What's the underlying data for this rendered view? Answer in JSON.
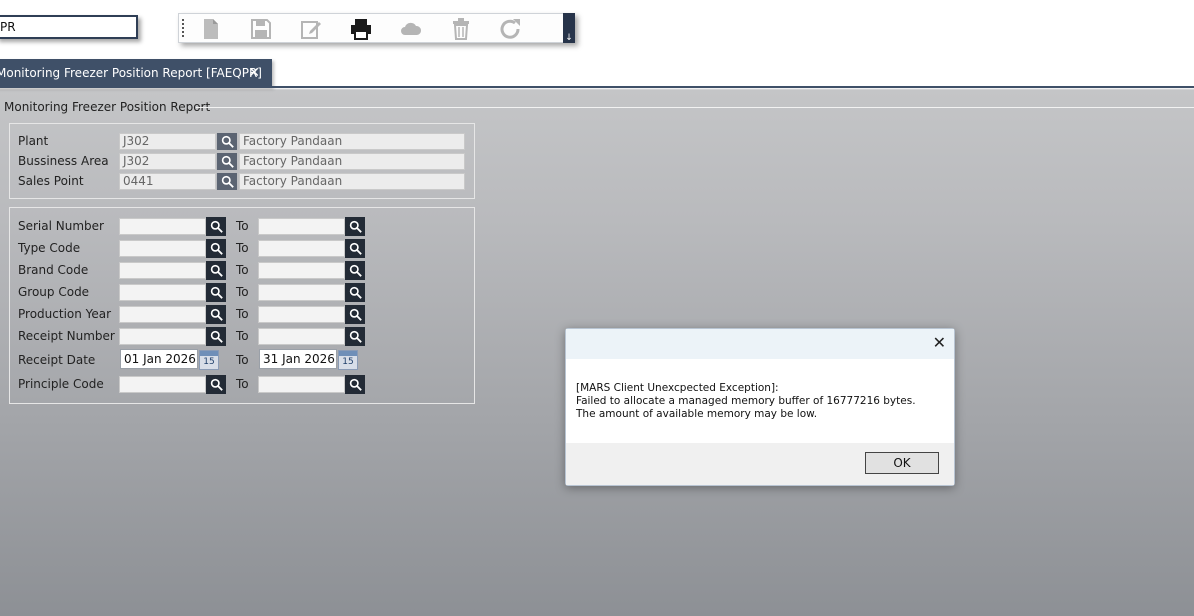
{
  "command": {
    "value": "PR"
  },
  "toolbar": {
    "buttons": [
      "new-icon",
      "save-icon",
      "edit-icon",
      "print-icon",
      "cloud-icon",
      "delete-icon",
      "redo-icon"
    ],
    "end_glyph": "↓"
  },
  "tab": {
    "label": "Monitoring Freezer Position Report [FAEQPR]",
    "close": "✕"
  },
  "form": {
    "title": "Monitoring Freezer Position Report",
    "header_fields": [
      {
        "label": "Plant",
        "code": "J302",
        "name": "Factory Pandaan"
      },
      {
        "label": "Bussiness Area",
        "code": "J302",
        "name": "Factory Pandaan"
      },
      {
        "label": "Sales Point",
        "code": "0441",
        "name": "Factory Pandaan"
      }
    ],
    "range_to_label": "To",
    "ranges": [
      {
        "label": "Serial Number",
        "from": "",
        "to": ""
      },
      {
        "label": "Type Code",
        "from": "",
        "to": ""
      },
      {
        "label": "Brand Code",
        "from": "",
        "to": ""
      },
      {
        "label": "Group Code",
        "from": "",
        "to": ""
      },
      {
        "label": "Production Year",
        "from": "",
        "to": ""
      },
      {
        "label": "Receipt Number",
        "from": "",
        "to": ""
      },
      {
        "label": "Receipt Date",
        "from": "01 Jan 2026",
        "to": "31 Jan 2026"
      },
      {
        "label": "Principle Code",
        "from": "",
        "to": ""
      }
    ],
    "calendar_day": "15"
  },
  "dialog": {
    "close": "✕",
    "line1": "[MARS Client Unexcpected Exception]:",
    "line2": "Failed to allocate a managed memory buffer of 16777216 bytes. The amount of available memory may be low.",
    "ok_label": "OK"
  }
}
